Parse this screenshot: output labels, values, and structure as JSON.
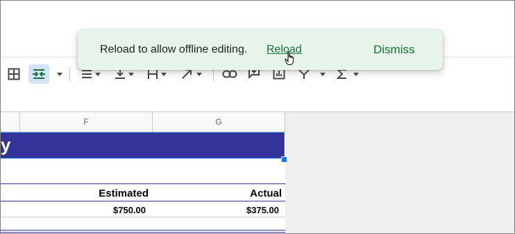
{
  "toast": {
    "message": "Reload to allow offline editing.",
    "reload_label": "Reload",
    "dismiss_label": "Dismiss"
  },
  "toolbar": {
    "icons": [
      "borders-icon",
      "merge-cells-icon",
      "horizontal-align-icon",
      "vertical-align-icon",
      "text-wrap-icon",
      "text-rotation-icon",
      "link-icon",
      "comment-icon",
      "chart-icon",
      "filter-icon",
      "functions-icon"
    ]
  },
  "grid": {
    "columns": [
      "F",
      "G"
    ],
    "title_fragment": "y",
    "headers": {
      "estimated": "Estimated",
      "actual": "Actual"
    },
    "values": {
      "estimated": "$750.00",
      "actual": "$375.00"
    }
  },
  "colors": {
    "title_band": "#333399",
    "toast_bg": "#e6f4ea",
    "toast_accent": "#137333",
    "selection": "#1a73e8"
  }
}
